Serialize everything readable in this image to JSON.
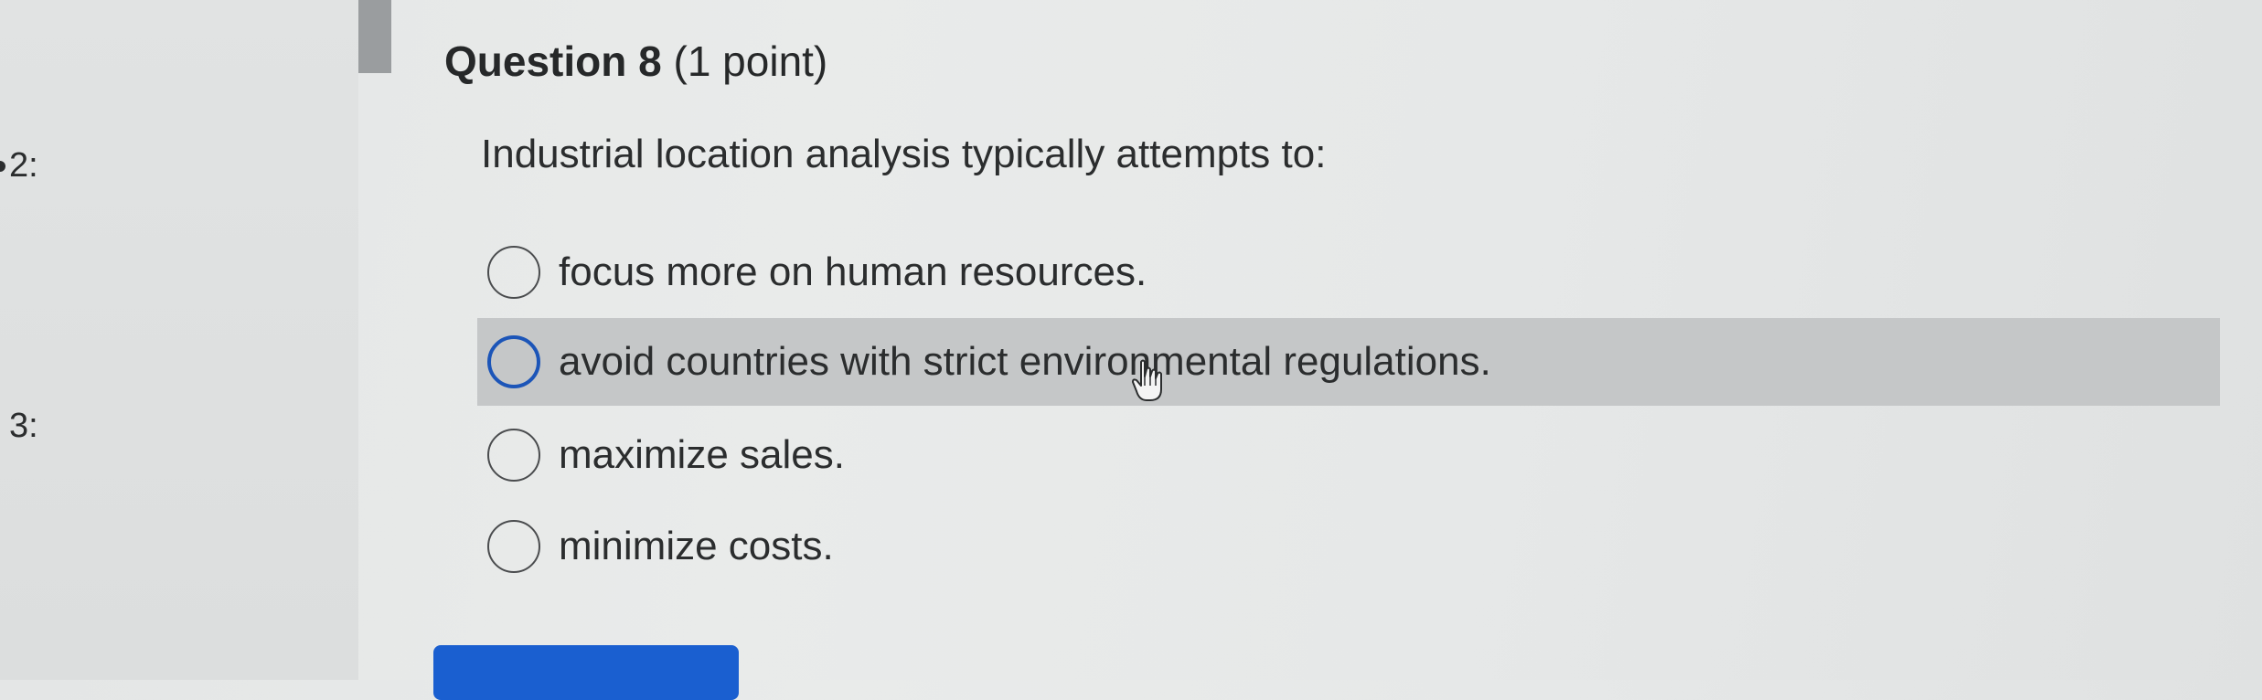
{
  "sidebar": {
    "items": [
      {
        "label": "2:"
      },
      {
        "label": "3:"
      }
    ]
  },
  "question": {
    "number_label": "Question 8",
    "points_label": "(1 point)",
    "prompt": "Industrial location analysis typically attempts to:",
    "options": [
      {
        "label": "focus more on human resources.",
        "selected": false
      },
      {
        "label": "avoid countries with strict environmental regulations.",
        "selected": false,
        "hovered": true
      },
      {
        "label": "maximize sales.",
        "selected": false
      },
      {
        "label": "minimize costs.",
        "selected": false
      }
    ]
  },
  "colors": {
    "accent": "#1a5fd0",
    "hover_row": "#c5c7c8",
    "radio_focus": "#1c55b8"
  },
  "icons": {
    "cursor": "hand-pointer-icon"
  }
}
